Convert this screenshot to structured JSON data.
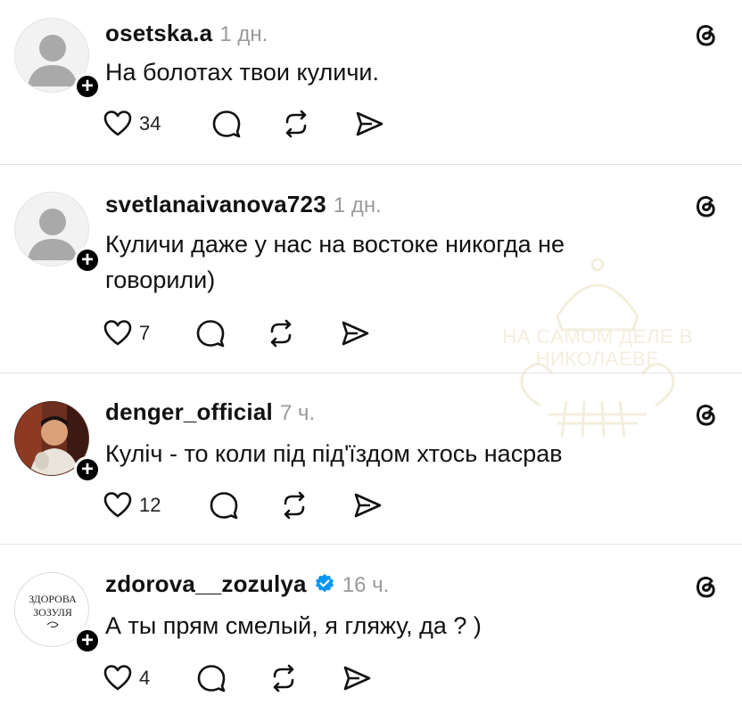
{
  "watermark": {
    "line1": "НА САМОМ ДЕЛЕ В",
    "line2": "НИКОЛАЕВЕ"
  },
  "posts": [
    {
      "username": "osetska.a",
      "time": "1 дн.",
      "text": "На болотах твои куличи.",
      "likes": "34",
      "verified": false,
      "avatar": "default-avatar"
    },
    {
      "username": "svetlanaivanova723",
      "time": "1 дн.",
      "text": "Куличи даже у нас на востоке никогда не говорили)",
      "likes": "7",
      "verified": false,
      "avatar": "default-avatar"
    },
    {
      "username": "denger_official",
      "time": "7 ч.",
      "text": "Куліч - то коли під під'їздом хтось насрав",
      "likes": "12",
      "verified": false,
      "avatar": "photo-avatar"
    },
    {
      "username": "zdorova__zozulya",
      "time": "16 ч.",
      "text": "А ты прям смелый, я гляжу, да ? )",
      "likes": "4",
      "verified": true,
      "avatar": "logo-avatar",
      "avatar_logo_text": "ЗДОРОВА ЗОЗУЛЯ"
    }
  ],
  "icons": {
    "like": "heart-icon",
    "reply": "comment-icon",
    "repost": "repost-icon",
    "share": "send-icon",
    "platform": "threads-icon",
    "follow": "plus-icon",
    "verified": "verified-badge-icon"
  },
  "colors": {
    "text": "#111111",
    "muted": "#9a9a9a",
    "divider": "#e3e3e3",
    "verified": "#0095f6",
    "watermark": "#b08a1a"
  }
}
